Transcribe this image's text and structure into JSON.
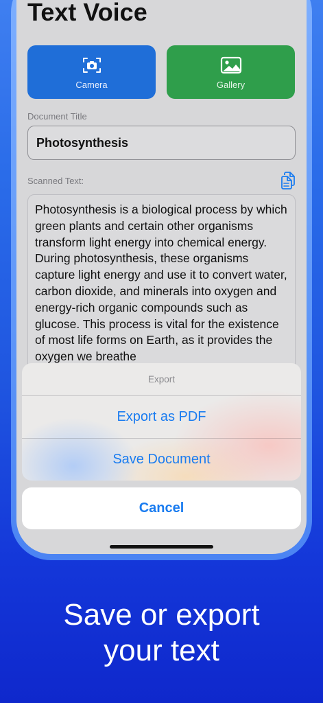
{
  "app": {
    "title": "Text Voice"
  },
  "actions": {
    "camera_label": "Camera",
    "gallery_label": "Gallery",
    "camera_color": "#1f6ed8",
    "gallery_color": "#2f9e4b"
  },
  "document": {
    "title_label": "Document Title",
    "title_value": "Photosynthesis",
    "scanned_label": "Scanned Text:",
    "scanned_text": "Photosynthesis is a biological process by which green plants and certain other organisms transform light energy into chemical energy. During photosynthesis, these organisms capture light energy and use it to convert water, carbon dioxide, and minerals into oxygen and energy-rich organic compounds such as glucose. This process is vital for the existence of most life forms on Earth, as it provides the oxygen we breathe"
  },
  "export_sheet": {
    "header": "Export",
    "options": [
      {
        "label": "Export as PDF"
      },
      {
        "label": "Save Document"
      }
    ],
    "cancel_label": "Cancel",
    "accent_color": "#1a7cf0"
  },
  "promo": {
    "caption_line1": "Save or export",
    "caption_line2": "your text"
  },
  "icons": {
    "camera": "camera-icon",
    "gallery": "photo-icon",
    "copy": "copy-icon"
  }
}
